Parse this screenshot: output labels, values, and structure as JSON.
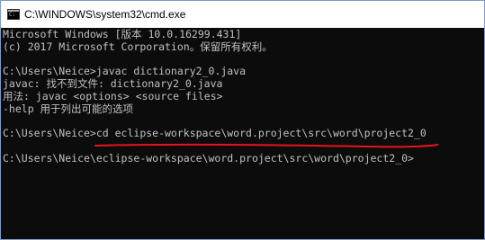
{
  "window": {
    "title": "C:\\WINDOWS\\system32\\cmd.exe",
    "icon": "cmd-icon"
  },
  "console": {
    "lines": [
      "Microsoft Windows [版本 10.0.16299.431]",
      "(c) 2017 Microsoft Corporation。保留所有权利。",
      "",
      "C:\\Users\\Neice>javac dictionary2_0.java",
      "javac: 找不到文件: dictionary2_0.java",
      "用法: javac <options> <source files>",
      "-help 用于列出可能的选项",
      "",
      "C:\\Users\\Neice>cd eclipse-workspace\\word.project\\src\\word\\project2_0",
      "",
      "C:\\Users\\Neice\\eclipse-workspace\\word.project\\src\\word\\project2_0>"
    ]
  },
  "colors": {
    "console_bg": "#0c0c0c",
    "console_text": "#c0c0c0",
    "annotation": "#e8141c"
  }
}
